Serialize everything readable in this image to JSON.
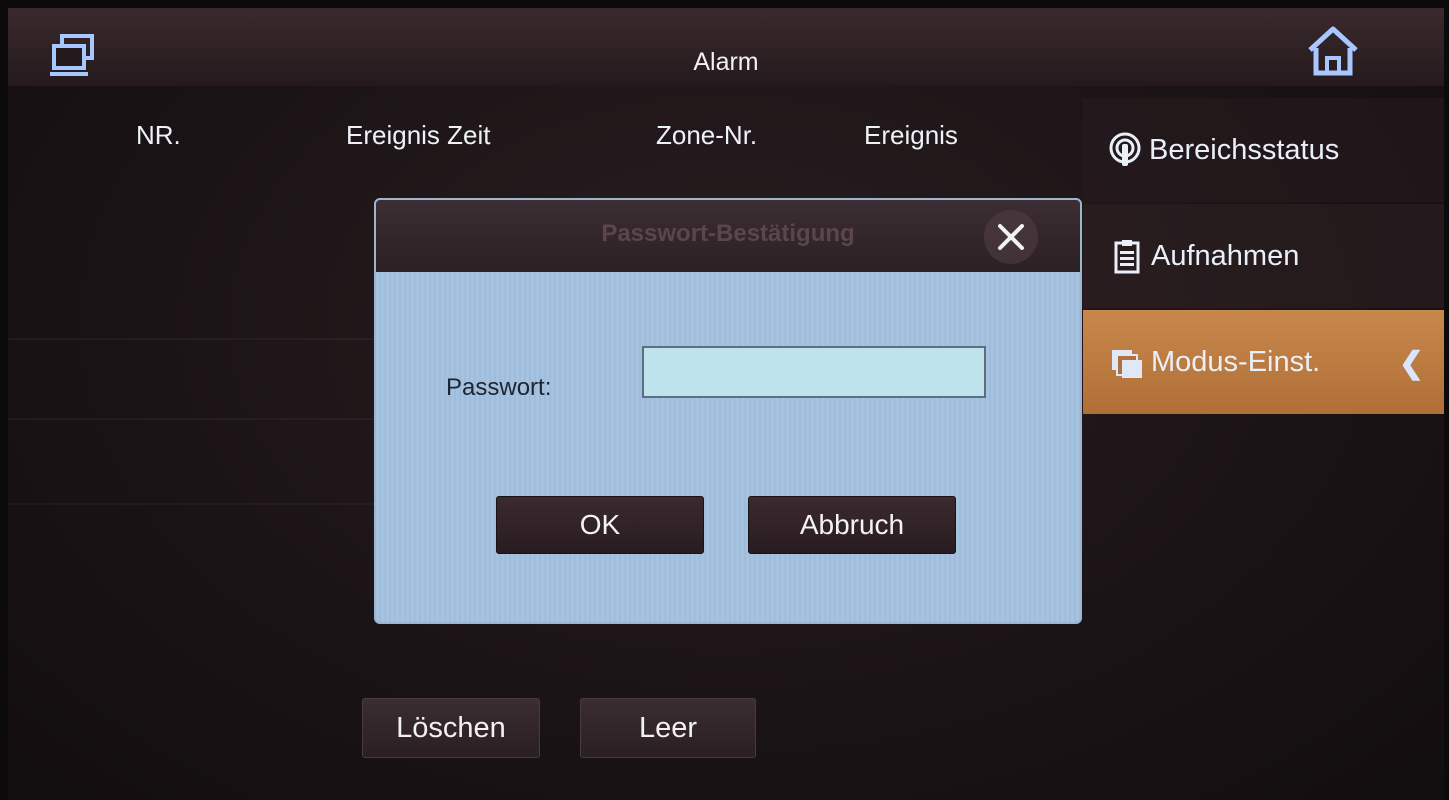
{
  "header": {
    "title": "Alarm"
  },
  "table": {
    "columns": [
      "NR.",
      "Ereignis Zeit",
      "Zone-Nr.",
      "Ereignis"
    ]
  },
  "sidebar": {
    "items": [
      {
        "label": "Bereichsstatus",
        "icon": "area-status-icon"
      },
      {
        "label": "Aufnahmen",
        "icon": "clipboard-icon"
      },
      {
        "label": "Modus-Einst.",
        "icon": "layers-icon",
        "selected": true
      }
    ]
  },
  "actions": {
    "delete_label": "Löschen",
    "clear_label": "Leer"
  },
  "dialog": {
    "title": "Passwort-Bestätigung",
    "password_label": "Passwort:",
    "password_value": "",
    "ok_label": "OK",
    "cancel_label": "Abbruch"
  },
  "colors": {
    "accent_selected": "#c8884c",
    "icon_blue": "#a9c7ff",
    "dialog_bg": "#a5c3e1"
  }
}
